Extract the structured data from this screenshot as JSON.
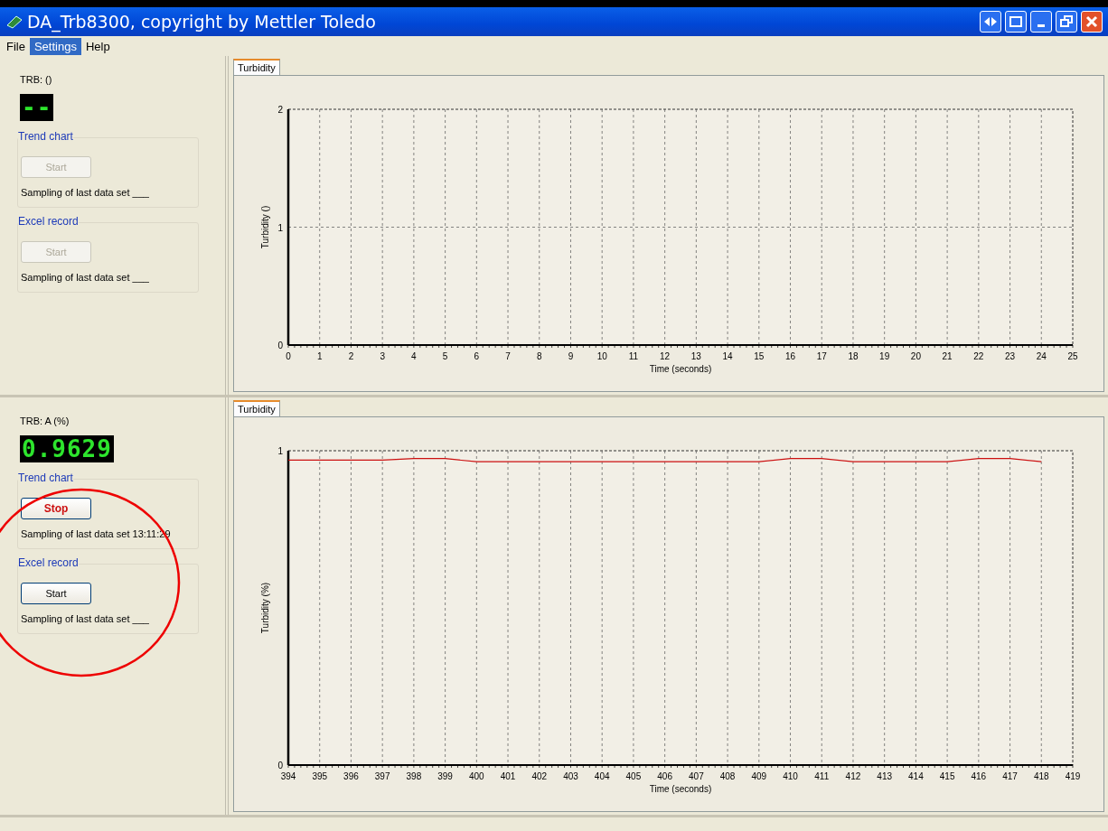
{
  "window": {
    "title": "DA_Trb8300, copyright by Mettler Toledo"
  },
  "menu": [
    {
      "label": "File",
      "selected": false
    },
    {
      "label": "Settings",
      "selected": true
    },
    {
      "label": "Help",
      "selected": false
    }
  ],
  "panes": [
    {
      "channel_label": "TRB: ()",
      "display": "--",
      "groups": [
        {
          "title": "Trend chart",
          "button": {
            "label": "Start",
            "kind": "start",
            "disabled": true
          },
          "sampling_label": "Sampling of last data set",
          "sampling_value": "___"
        },
        {
          "title": "Excel record",
          "button": {
            "label": "Start",
            "kind": "start",
            "disabled": true
          },
          "sampling_label": "Sampling of last data set",
          "sampling_value": "___"
        }
      ],
      "tab": {
        "label": "Turbidity",
        "selected": true
      },
      "chart_data": {
        "type": "line",
        "grid": true,
        "xlabel": "Time (seconds)",
        "ylabel": "Turbidity ()",
        "xlim": [
          0,
          25
        ],
        "ylim": [
          0,
          2
        ],
        "xticks": [
          0,
          1,
          2,
          3,
          4,
          5,
          6,
          7,
          8,
          9,
          10,
          11,
          12,
          13,
          14,
          15,
          16,
          17,
          18,
          19,
          20,
          21,
          22,
          23,
          24,
          25
        ],
        "yticks": [
          0,
          1,
          2
        ]
      }
    },
    {
      "channel_label": "TRB: A (%)",
      "display": "0.9629",
      "groups": [
        {
          "title": "Trend chart",
          "button": {
            "label": "Stop",
            "kind": "stop",
            "disabled": false
          },
          "sampling_label": "Sampling of last data set",
          "sampling_value": "13:11:29"
        },
        {
          "title": "Excel record",
          "button": {
            "label": "Start",
            "kind": "start",
            "disabled": false
          },
          "sampling_label": "Sampling of last data set",
          "sampling_value": "___"
        }
      ],
      "tab": {
        "label": "Turbidity",
        "selected": true
      },
      "chart_data": {
        "type": "line",
        "grid": true,
        "xlabel": "Time (seconds)",
        "ylabel": "Turbidity (%)",
        "xlim": [
          394,
          419
        ],
        "ylim": [
          0,
          1
        ],
        "xticks": [
          394,
          395,
          396,
          397,
          398,
          399,
          400,
          401,
          402,
          403,
          404,
          405,
          406,
          407,
          408,
          409,
          410,
          411,
          412,
          413,
          414,
          415,
          416,
          417,
          418,
          419
        ],
        "yticks": [
          0,
          1
        ],
        "x": [
          394,
          395,
          396,
          397,
          398,
          399,
          400,
          401,
          402,
          403,
          404,
          405,
          406,
          407,
          408,
          409,
          410,
          411,
          412,
          413,
          414,
          415,
          416,
          417,
          418
        ],
        "series": [
          {
            "color": "#cc1111",
            "values": [
              0.97,
              0.97,
              0.97,
              0.97,
              0.975,
              0.975,
              0.965,
              0.965,
              0.965,
              0.965,
              0.965,
              0.965,
              0.965,
              0.965,
              0.965,
              0.965,
              0.975,
              0.975,
              0.965,
              0.965,
              0.965,
              0.965,
              0.975,
              0.975,
              0.965
            ]
          }
        ]
      }
    }
  ]
}
